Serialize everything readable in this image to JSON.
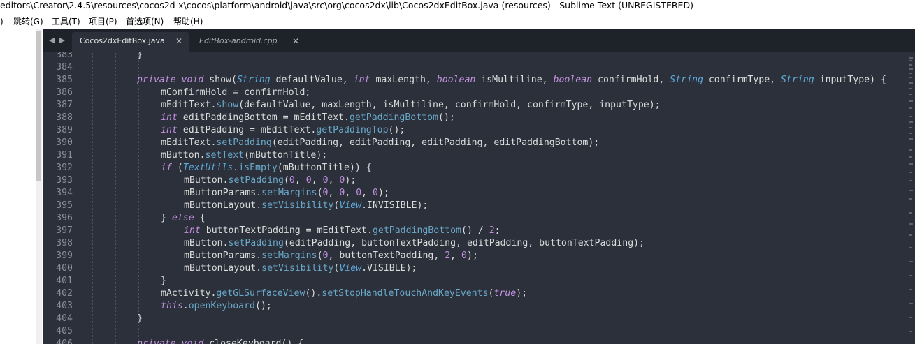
{
  "window": {
    "title": "editors\\Creator\\2.4.5\\resources\\cocos2d-x\\cocos\\platform\\android\\java\\src\\org\\cocos2dx\\lib\\Cocos2dxEditBox.java (resources) - Sublime Text (UNREGISTERED)"
  },
  "menu": {
    "partial": ")",
    "goto": "跳转(G)",
    "tools": "工具(T)",
    "project": "项目(P)",
    "preferences": "首选项(N)",
    "help": "帮助(H)"
  },
  "tabs": [
    {
      "label": "Cocos2dxEditBox.java",
      "active": true
    },
    {
      "label": "EditBox-android.cpp",
      "active": false
    }
  ],
  "colors": {
    "editor_bg": "#2b303b",
    "tabbar_bg": "#1e2229",
    "keyword": "#c391e0",
    "type": "#5fa8d8",
    "method": "#6aa8c8",
    "identifier": "#f3a34d"
  },
  "code_lines": [
    {
      "n": "383",
      "text": "}"
    },
    {
      "n": "384",
      "text": ""
    },
    {
      "n": "385",
      "text": "private void show(String defaultValue, int maxLength, boolean isMultiline, boolean confirmHold, String confirmType, String inputType) {"
    },
    {
      "n": "386",
      "text": "mConfirmHold = confirmHold;"
    },
    {
      "n": "387",
      "text": "mEditText.show(defaultValue, maxLength, isMultiline, confirmHold, confirmType, inputType);"
    },
    {
      "n": "388",
      "text": "int editPaddingBottom = mEditText.getPaddingBottom();"
    },
    {
      "n": "389",
      "text": "int editPadding = mEditText.getPaddingTop();"
    },
    {
      "n": "390",
      "text": "mEditText.setPadding(editPadding, editPadding, editPadding, editPaddingBottom);"
    },
    {
      "n": "391",
      "text": "mButton.setText(mButtonTitle);"
    },
    {
      "n": "392",
      "text": "if (TextUtils.isEmpty(mButtonTitle)) {"
    },
    {
      "n": "393",
      "text": "mButton.setPadding(0, 0, 0, 0);"
    },
    {
      "n": "394",
      "text": "mButtonParams.setMargins(0, 0, 0, 0);"
    },
    {
      "n": "395",
      "text": "mButtonLayout.setVisibility(View.INVISIBLE);"
    },
    {
      "n": "396",
      "text": "} else {"
    },
    {
      "n": "397",
      "text": "int buttonTextPadding = mEditText.getPaddingBottom() / 2;"
    },
    {
      "n": "398",
      "text": "mButton.setPadding(editPadding, buttonTextPadding, editPadding, buttonTextPadding);"
    },
    {
      "n": "399",
      "text": "mButtonParams.setMargins(0, buttonTextPadding, 2, 0);"
    },
    {
      "n": "400",
      "text": "mButtonLayout.setVisibility(View.VISIBLE);"
    },
    {
      "n": "401",
      "text": "}"
    },
    {
      "n": "402",
      "text": "mActivity.getGLSurfaceView().setStopHandleTouchAndKeyEvents(true);"
    },
    {
      "n": "403",
      "text": "this.openKeyboard();"
    },
    {
      "n": "404",
      "text": "}"
    },
    {
      "n": "405",
      "text": ""
    },
    {
      "n": "406",
      "text": "private void closeKeyboard() {"
    }
  ]
}
